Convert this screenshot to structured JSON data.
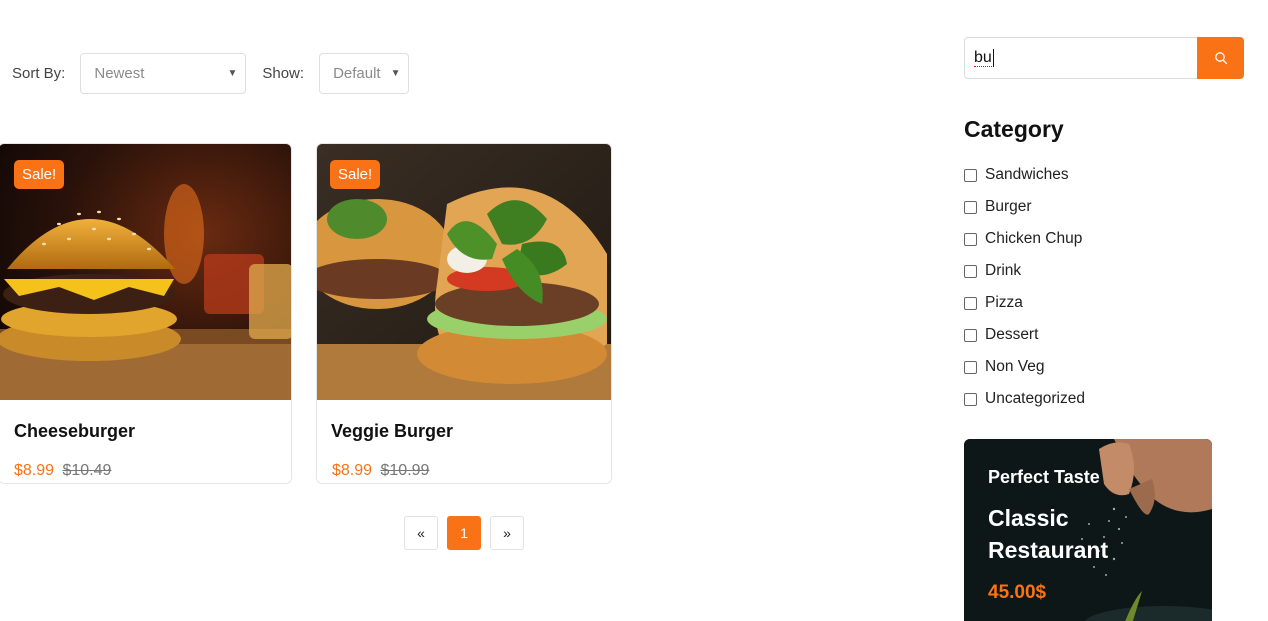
{
  "toolbar": {
    "sort_label": "Sort By:",
    "sort_value": "Newest",
    "show_label": "Show:",
    "show_value": "Default"
  },
  "products": [
    {
      "badge": "Sale!",
      "name": "Cheeseburger",
      "price": "$8.99",
      "old_price": "$10.49"
    },
    {
      "badge": "Sale!",
      "name": "Veggie Burger",
      "price": "$8.99",
      "old_price": "$10.99"
    }
  ],
  "pagination": {
    "prev": "«",
    "current": "1",
    "next": "»"
  },
  "sidebar": {
    "search_value": "bu",
    "category_title": "Category",
    "categories": [
      "Sandwiches",
      "Burger",
      "Chicken Chup",
      "Drink",
      "Pizza",
      "Dessert",
      "Non Veg",
      "Uncategorized"
    ],
    "promo": {
      "tagline": "Perfect Taste",
      "title": "Classic Restaurant",
      "price": "45.00$"
    }
  },
  "colors": {
    "accent": "#f97316",
    "promo_bg": "#0d1718"
  }
}
